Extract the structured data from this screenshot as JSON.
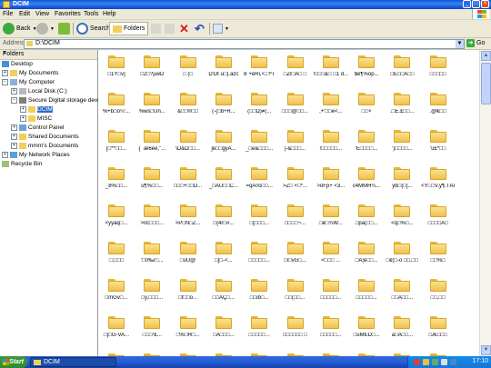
{
  "window": {
    "title": "DCIM"
  },
  "menu": [
    "File",
    "Edit",
    "View",
    "Favorites",
    "Tools",
    "Help"
  ],
  "toolbar": {
    "back": "Back",
    "search": "Search",
    "folders": "Folders"
  },
  "address": {
    "label": "Address",
    "value": "D:\\DCIM",
    "go": "Go"
  },
  "folders_pane": {
    "title": "Folders",
    "tree": [
      {
        "label": "Desktop",
        "icon": "desktop-icon"
      },
      {
        "label": "My Documents",
        "icon": "documents-icon"
      },
      {
        "label": "My Computer",
        "icon": "computer-icon"
      },
      {
        "label": "Local Disk (C:)",
        "icon": "disk-icon"
      },
      {
        "label": "Secure Digital storage device",
        "icon": "sd-card-icon"
      },
      {
        "label": "DCIM",
        "icon": "folder-icon",
        "selected": true
      },
      {
        "label": "MISC",
        "icon": "folder-icon"
      },
      {
        "label": "Control Panel",
        "icon": "control-panel-icon"
      },
      {
        "label": "Shared Documents",
        "icon": "folder-icon"
      },
      {
        "label": "mmm's Documents",
        "icon": "folder-icon"
      },
      {
        "label": "My Network Places",
        "icon": "network-icon"
      },
      {
        "label": "Recycle Bin",
        "icon": "recycle-bin-icon"
      }
    ]
  },
  "files": [
    "□1Y□v]",
    "□2□?µwD",
    "□ (□",
    "D'Dt u□).azc",
    "8`+èRi,<.□ªT",
    "□ZI□Ä□ □",
    "!□□□&□ □1 d...",
    "$é¶%ôp...",
    "□Ë□□Ä□□",
    "□□□□□",
    "%+b□o¼'...",
    "%ws□Ûn...",
    "&□□®□□",
    "(-{□b÷R...",
    "(□□Ω)≠(...",
    "□□□@□□...",
    ",+'□□e<...",
    "□□×",
    ".□Ë.£□□...",
    ".@€□□",
    "[□**□□...",
    "{ `æ6èe,\"...",
    "\\D&D□□...",
    "]ë□□gyA...",
    "_□e&□□□...",
    "|-&□□□...",
    "!□□□□□...",
    "'Ë□□□□...",
    "')□□□□...",
    "'ù£*□□",
    "_8%□□...",
    "u¶%□□...",
    "□□□+□□Õ...",
    "_□ÀÜ□□C...",
    "=qÂ◊o□□...",
    ">Z□ ×□*...",
    ">ôFp+ <3...",
    "c4MMH¼...",
    "yb□{□]...",
    "<Y□□V,y¶.TÂI",
    "<yyàq□...",
    ">0c□□□...",
    ">P□N□Z...",
    "□{4r□#...",
    "□[□□□...",
    "□□□□¬...",
    "□è□¾W...",
    "□pa(□□...",
    "<q□%□...",
    "□□□□Å□",
    "□;□□□",
    "'□0‰r□...",
    "□ùÜ@",
    "□[□-<...",
    "□□□□□...",
    "□i□vG□...",
    "<□□□ ...",
    "□Ä¦e□□...",
    "□ê¦□-õ □□,□□",
    "□□%□",
    "□mGv□...",
    "□y,□□□...",
    "□f□□o...",
    "□□ÄÇ□...",
    "□□ib□...",
    "□□(□□...",
    "□□□□□...",
    "□□□□□...",
    "□□Ä□□...",
    "□□,□□",
    "□]□G-VA...",
    "□□□¹£...",
    "□%□H□...",
    "□Â□□□...",
    "□□□□□...",
    "□□□□□□ □",
    "□□□□□...",
    "□uMED□...",
    "ã□À□□...",
    "□Æ□□□"
  ],
  "taskbar": {
    "start": "Start",
    "task": "DCIM",
    "clock": "17:10"
  }
}
